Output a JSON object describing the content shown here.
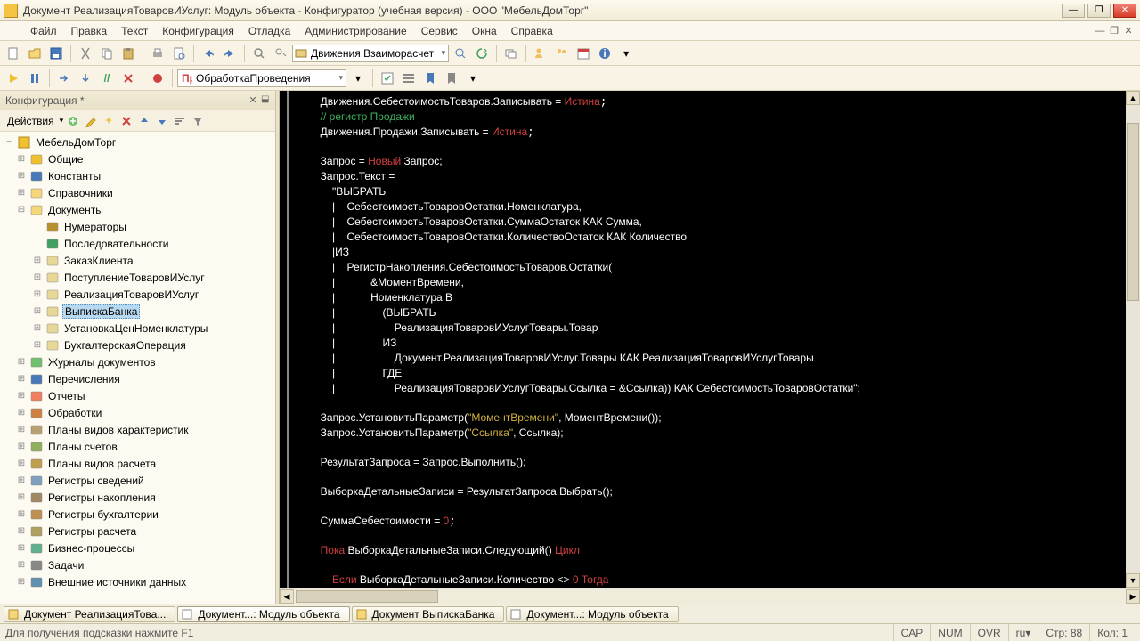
{
  "window": {
    "title": "Документ РеализацияТоваровИУслуг: Модуль объекта - Конфигуратор (учебная версия) - ООО \"МебельДомТорг\""
  },
  "menu": {
    "file": "Файл",
    "edit": "Правка",
    "text": "Текст",
    "config": "Конфигурация",
    "debug": "Отладка",
    "admin": "Администрирование",
    "service": "Сервис",
    "windows": "Окна",
    "help": "Справка"
  },
  "toolbar": {
    "combo1": "Движения.Взаиморасчет",
    "combo2": "ОбработкаПроведения"
  },
  "sidebar": {
    "title": "Конфигурация *",
    "actions_label": "Действия",
    "root": "МебельДомТорг",
    "items": [
      {
        "label": "Общие",
        "icon": "common",
        "exp": "+"
      },
      {
        "label": "Константы",
        "icon": "const",
        "exp": "+"
      },
      {
        "label": "Справочники",
        "icon": "ref",
        "exp": "+"
      },
      {
        "label": "Документы",
        "icon": "doc",
        "exp": "-",
        "children": [
          {
            "label": "Нумераторы",
            "icon": "num"
          },
          {
            "label": "Последовательности",
            "icon": "seq"
          },
          {
            "label": "ЗаказКлиента",
            "icon": "docitem",
            "exp": "+"
          },
          {
            "label": "ПоступлениеТоваровИУслуг",
            "icon": "docitem",
            "exp": "+"
          },
          {
            "label": "РеализацияТоваровИУслуг",
            "icon": "docitem",
            "exp": "+"
          },
          {
            "label": "ВыпискаБанка",
            "icon": "docitem",
            "exp": "+",
            "selected": true
          },
          {
            "label": "УстановкаЦенНоменклатуры",
            "icon": "docitem",
            "exp": "+"
          },
          {
            "label": "БухгалтерскаяОперация",
            "icon": "docitem",
            "exp": "+"
          }
        ]
      },
      {
        "label": "Журналы документов",
        "icon": "journal",
        "exp": "+"
      },
      {
        "label": "Перечисления",
        "icon": "enum",
        "exp": "+"
      },
      {
        "label": "Отчеты",
        "icon": "report",
        "exp": "+"
      },
      {
        "label": "Обработки",
        "icon": "proc",
        "exp": "+"
      },
      {
        "label": "Планы видов характеристик",
        "icon": "plan",
        "exp": "+"
      },
      {
        "label": "Планы счетов",
        "icon": "accounts",
        "exp": "+"
      },
      {
        "label": "Планы видов расчета",
        "icon": "calc",
        "exp": "+"
      },
      {
        "label": "Регистры сведений",
        "icon": "reginfo",
        "exp": "+"
      },
      {
        "label": "Регистры накопления",
        "icon": "regaccum",
        "exp": "+"
      },
      {
        "label": "Регистры бухгалтерии",
        "icon": "regbook",
        "exp": "+"
      },
      {
        "label": "Регистры расчета",
        "icon": "regcalc",
        "exp": "+"
      },
      {
        "label": "Бизнес-процессы",
        "icon": "bp",
        "exp": "+"
      },
      {
        "label": "Задачи",
        "icon": "task",
        "exp": "+"
      },
      {
        "label": "Внешние источники данных",
        "icon": "extsrc",
        "exp": "+"
      }
    ]
  },
  "code": {
    "l1a": "Движения.СебестоимостьТоваров.Записывать = ",
    "l1b": "Истина",
    "l2": "// регистр Продажи",
    "l3a": "Движения.Продажи.Записывать = ",
    "l3b": "Истина",
    "l5a": "Запрос = ",
    "l5b": "Новый",
    "l5c": " Запрос;",
    "l6": "Запрос.Текст =",
    "l7": "    \"ВЫБРАТЬ",
    "l8": "    |    СебестоимостьТоваровОстатки.Номенклатура,",
    "l9": "    |    СебестоимостьТоваровОстатки.СуммаОстаток КАК Сумма,",
    "l10": "    |    СебестоимостьТоваровОстатки.КоличествоОстаток КАК Количество",
    "l11": "    |ИЗ",
    "l12": "    |    РегистрНакопления.СебестоимостьТоваров.Остатки(",
    "l13": "    |            &МоментВремени,",
    "l14": "    |            Номенклатура В",
    "l15": "    |                (ВЫБРАТЬ",
    "l16": "    |                    РеализацияТоваровИУслугТовары.Товар",
    "l17": "    |                ИЗ",
    "l18": "    |                    Документ.РеализацияТоваровИУслуг.Товары КАК РеализацияТоваровИУслугТовары",
    "l19": "    |                ГДЕ",
    "l20": "    |                    РеализацияТоваровИУслугТовары.Ссылка = &Ссылка)) КАК СебестоимостьТоваровОстатки\";",
    "l22a": "Запрос.УстановитьПараметр(",
    "l22b": "\"МоментВремени\"",
    "l22c": ", МоментВремени());",
    "l23a": "Запрос.УстановитьПараметр(",
    "l23b": "\"Ссылка\"",
    "l23c": ", Ссылка);",
    "l25": "РезультатЗапроса = Запрос.Выполнить();",
    "l27": "ВыборкаДетальныеЗаписи = РезультатЗапроса.Выбрать();",
    "l29a": "СуммаСебестоимости = ",
    "l29b": "0",
    "l31a": "Пока ",
    "l31b": "ВыборкаДетальныеЗаписи.Следующий() ",
    "l31c": "Цикл",
    "l33a": "    Если ",
    "l33b": "ВыборкаДетальныеЗаписи.Количество <> ",
    "l33c": "0",
    "l33d": " Тогда"
  },
  "tabs": {
    "t1": "Документ РеализацияТова...",
    "t2": "Документ...: Модуль объекта",
    "t3": "Документ ВыпискаБанка",
    "t4": "Документ...: Модуль объекта"
  },
  "status": {
    "hint": "Для получения подсказки нажмите F1",
    "cap": "CAP",
    "num": "NUM",
    "ovr": "OVR",
    "lang": "ru",
    "row_lbl": "Стр:",
    "row": "88",
    "col_lbl": "Кол:",
    "col": "1"
  }
}
